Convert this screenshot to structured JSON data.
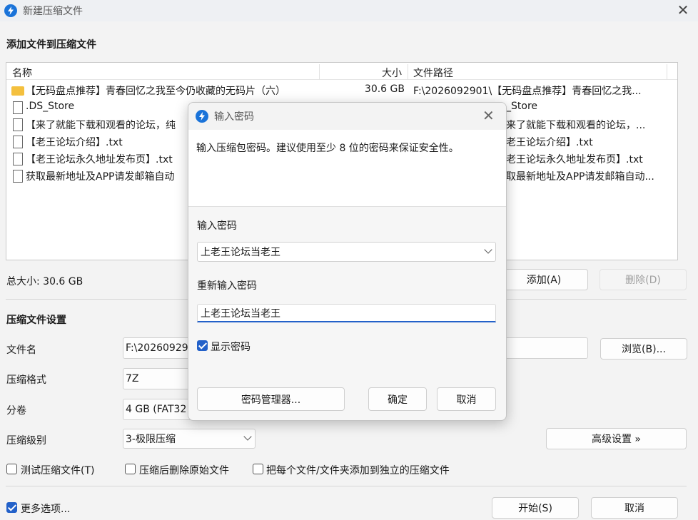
{
  "window": {
    "title": "新建压缩文件",
    "close_glyph": "✕"
  },
  "files_section": {
    "title": "添加文件到压缩文件",
    "columns": {
      "name": "名称",
      "size": "大小",
      "path": "文件路径"
    },
    "rows": [
      {
        "icon": "folder-icon",
        "name": "【无码盘点推荐】青春回忆之我至今仍收藏的无码片（六）",
        "size": "30.6 GB",
        "path": "F:\\2026092901\\【无码盘点推荐】青春回忆之我..."
      },
      {
        "icon": "file-icon",
        "name": ".DS_Store",
        "size": "",
        "path": "_Store"
      },
      {
        "icon": "file-icon",
        "name": "【来了就能下载和观看的论坛，纯",
        "size": "",
        "path": "来了就能下载和观看的论坛，..."
      },
      {
        "icon": "file-icon",
        "name": "【老王论坛介绍】.txt",
        "size": "",
        "path": "老王论坛介绍】.txt"
      },
      {
        "icon": "file-icon",
        "name": "【老王论坛永久地址发布页】.txt",
        "size": "",
        "path": "老王论坛永久地址发布页】.txt"
      },
      {
        "icon": "file-icon",
        "name": "获取最新地址及APP请发邮箱自动",
        "size": "",
        "path": "取最新地址及APP请发邮箱自动..."
      }
    ],
    "total_size": "总大小: 30.6 GB",
    "add_button": "添加(A)",
    "delete_button": "删除(D)"
  },
  "settings": {
    "title": "压缩文件设置",
    "filename_label": "文件名",
    "filename_value": "F:\\20260929",
    "browse_button": "浏览(B)...",
    "format_label": "压缩格式",
    "format_value": "7Z",
    "split_label": "分卷",
    "split_value": "4 GB (FAT32",
    "level_label": "压缩级别",
    "level_value": "3-极限压缩",
    "advanced_button": "高级设置 »",
    "test_checkbox": "测试压缩文件(T)",
    "delete_after_checkbox": "压缩后删除原始文件",
    "separate_checkbox": "把每个文件/文件夹添加到独立的压缩文件",
    "more_options_checkbox": "更多选项...",
    "start_button": "开始(S)",
    "cancel_button": "取消"
  },
  "dialog": {
    "title": "输入密码",
    "close_glyph": "✕",
    "description": "输入压缩包密码。建议使用至少 8 位的密码来保证安全性。",
    "password_label": "输入密码",
    "password_value": "上老王论坛当老王",
    "confirm_label": "重新输入密码",
    "confirm_value": "上老王论坛当老王",
    "show_password": "显示密码",
    "manager_button": "密码管理器...",
    "ok_button": "确定",
    "cancel_button": "取消"
  },
  "colors": {
    "accent": "#2361c9",
    "app_icon": "#1a73d9",
    "folder": "#f4c03e"
  }
}
